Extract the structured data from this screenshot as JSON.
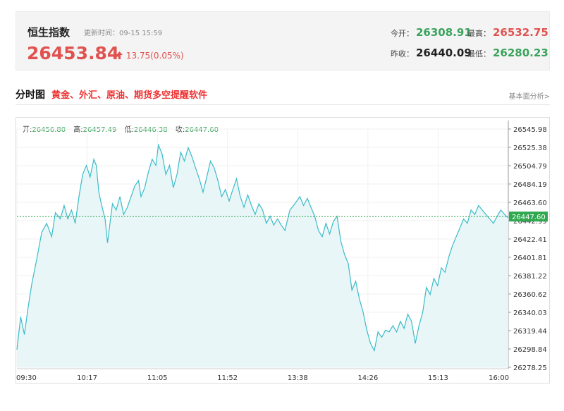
{
  "quote": {
    "name": "恒生指数",
    "update_time": "更新时间：09-15 15:59",
    "price": "26453.84",
    "change": "13.75(0.05%)",
    "change_arrow": "up-arrow-icon",
    "open_label": "今开：",
    "open": "26308.91",
    "high_label": "最高：",
    "high": "26532.75",
    "prev_close_label": "昨收：",
    "prev_close": "26440.09",
    "low_label": "最低：",
    "low": "26280.23"
  },
  "section": {
    "title": "分时图",
    "promo": "黄金、外汇、原油、期货多空提醒软件",
    "fundamental_link": "基本面分析>"
  },
  "ohlc": {
    "open_label": "开:",
    "open": "26456.80",
    "high_label": "高:",
    "high": "26457.49",
    "low_label": "低:",
    "low": "26446.38",
    "close_label": "收:",
    "close": "26447.60"
  },
  "colors": {
    "up": "#e0524f",
    "down": "#3aa35c",
    "line": "#3bbcc8",
    "fill": "#e8f6f8",
    "ref_line": "#2fa84f"
  },
  "chart_data": {
    "type": "line",
    "title": "",
    "xlabel": "",
    "ylabel": "",
    "x_ticks": [
      "09:30",
      "10:17",
      "11:05",
      "11:52",
      "13:38",
      "14:26",
      "15:13",
      "16:00"
    ],
    "y_ticks": [
      26545.98,
      26525.38,
      26504.79,
      26484.19,
      26463.6,
      26442.99,
      26422.41,
      26401.81,
      26381.22,
      26360.62,
      26340.03,
      26319.44,
      26298.84,
      26278.25
    ],
    "ylim": [
      26278.25,
      26545.98
    ],
    "reference_value": 26447.6,
    "reference_label": "26447.60",
    "grid": true,
    "series": [
      {
        "points": [
          [
            0,
            26298
          ],
          [
            3,
            26335
          ],
          [
            6,
            26315
          ],
          [
            9,
            26345
          ],
          [
            12,
            26372
          ],
          [
            16,
            26400
          ],
          [
            20,
            26430
          ],
          [
            24,
            26440
          ],
          [
            28,
            26425
          ],
          [
            31,
            26452
          ],
          [
            35,
            26445
          ],
          [
            38,
            26460
          ],
          [
            41,
            26445
          ],
          [
            44,
            26455
          ],
          [
            47,
            26440
          ],
          [
            50,
            26470
          ],
          [
            53,
            26495
          ],
          [
            56,
            26505
          ],
          [
            59,
            26492
          ],
          [
            62,
            26512
          ],
          [
            64,
            26505
          ],
          [
            66,
            26475
          ],
          [
            68,
            26462
          ],
          [
            71,
            26445
          ],
          [
            73,
            26418
          ],
          [
            75,
            26440
          ],
          [
            77,
            26462
          ],
          [
            80,
            26455
          ],
          [
            83,
            26470
          ],
          [
            86,
            26450
          ],
          [
            89,
            26458
          ],
          [
            92,
            26470
          ],
          [
            95,
            26482
          ],
          [
            98,
            26488
          ],
          [
            100,
            26470
          ],
          [
            103,
            26480
          ],
          [
            106,
            26498
          ],
          [
            109,
            26512
          ],
          [
            112,
            26505
          ],
          [
            114,
            26528
          ],
          [
            117,
            26518
          ],
          [
            120,
            26495
          ],
          [
            123,
            26505
          ],
          [
            126,
            26480
          ],
          [
            129,
            26495
          ],
          [
            132,
            26520
          ],
          [
            135,
            26510
          ],
          [
            138,
            26525
          ],
          [
            141,
            26515
          ],
          [
            144,
            26502
          ],
          [
            147,
            26490
          ],
          [
            150,
            26475
          ],
          [
            153,
            26492
          ],
          [
            156,
            26510
          ],
          [
            159,
            26502
          ],
          [
            162,
            26488
          ],
          [
            165,
            26470
          ],
          [
            168,
            26478
          ],
          [
            171,
            26465
          ],
          [
            174,
            26478
          ],
          [
            177,
            26490
          ],
          [
            180,
            26470
          ],
          [
            183,
            26458
          ],
          [
            186,
            26472
          ],
          [
            189,
            26460
          ],
          [
            192,
            26450
          ],
          [
            195,
            26462
          ],
          [
            198,
            26455
          ],
          [
            201,
            26440
          ],
          [
            204,
            26448
          ],
          [
            207,
            26438
          ],
          [
            210,
            26445
          ],
          [
            213,
            26438
          ],
          [
            216,
            26432
          ],
          [
            220,
            26455
          ],
          [
            224,
            26462
          ],
          [
            228,
            26470
          ],
          [
            231,
            26460
          ],
          [
            234,
            26468
          ],
          [
            237,
            26458
          ],
          [
            240,
            26448
          ],
          [
            243,
            26432
          ],
          [
            246,
            26425
          ],
          [
            249,
            26440
          ],
          [
            252,
            26428
          ],
          [
            255,
            26442
          ],
          [
            258,
            26448
          ],
          [
            261,
            26420
          ],
          [
            264,
            26405
          ],
          [
            267,
            26395
          ],
          [
            270,
            26365
          ],
          [
            273,
            26375
          ],
          [
            276,
            26355
          ],
          [
            279,
            26340
          ],
          [
            282,
            26320
          ],
          [
            285,
            26305
          ],
          [
            288,
            26297
          ],
          [
            291,
            26318
          ],
          [
            294,
            26312
          ],
          [
            297,
            26320
          ],
          [
            300,
            26318
          ],
          [
            303,
            26325
          ],
          [
            306,
            26318
          ],
          [
            309,
            26330
          ],
          [
            312,
            26322
          ],
          [
            315,
            26338
          ],
          [
            318,
            26330
          ],
          [
            321,
            26305
          ],
          [
            324,
            26325
          ],
          [
            327,
            26340
          ],
          [
            330,
            26368
          ],
          [
            333,
            26360
          ],
          [
            336,
            26378
          ],
          [
            339,
            26370
          ],
          [
            342,
            26390
          ],
          [
            345,
            26385
          ],
          [
            348,
            26402
          ],
          [
            351,
            26415
          ],
          [
            354,
            26425
          ],
          [
            357,
            26435
          ],
          [
            360,
            26445
          ],
          [
            363,
            26440
          ],
          [
            366,
            26455
          ],
          [
            369,
            26450
          ],
          [
            372,
            26460
          ],
          [
            375,
            26455
          ],
          [
            378,
            26450
          ],
          [
            381,
            26445
          ],
          [
            384,
            26440
          ],
          [
            387,
            26448
          ],
          [
            390,
            26455
          ],
          [
            393,
            26450
          ],
          [
            396,
            26446
          ]
        ]
      }
    ],
    "x_max": 396
  }
}
